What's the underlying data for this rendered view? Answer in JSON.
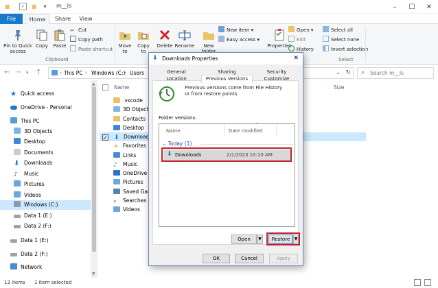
{
  "window": {
    "title": "m__ls"
  },
  "tabs": {
    "file": "File",
    "home": "Home",
    "share": "Share",
    "view": "View"
  },
  "ribbon": {
    "pin": "Pin to Quick access",
    "copy": "Copy",
    "paste": "Paste",
    "cut": "Cut",
    "copy_path": "Copy path",
    "paste_shortcut": "Paste shortcut",
    "move_to": "Move to",
    "copy_to": "Copy to",
    "delete": "Delete",
    "rename": "Rename",
    "new_folder": "New folder",
    "new_item": "New item",
    "easy_access": "Easy access",
    "properties": "Properties",
    "open": "Open",
    "edit": "Edit",
    "history": "History",
    "select_all": "Select all",
    "select_none": "Select none",
    "invert_selection": "Invert selection",
    "group_clipboard": "Clipboard",
    "group_select": "Select"
  },
  "address": {
    "path": [
      "This PC",
      "Windows (C:)",
      "Users"
    ],
    "search_placeholder": "Search m__ls"
  },
  "columns": {
    "name": "Name",
    "size": "Size"
  },
  "nav": [
    {
      "label": "Quick access",
      "icon": "star-icon"
    },
    {
      "label": "OneDrive - Personal",
      "icon": "cloud-icon"
    },
    {
      "label": "This PC",
      "icon": "pc-icon"
    },
    {
      "label": "3D Objects",
      "icon": "folder-icon"
    },
    {
      "label": "Desktop",
      "icon": "folder-icon"
    },
    {
      "label": "Documents",
      "icon": "folder-icon"
    },
    {
      "label": "Downloads",
      "icon": "download-icon"
    },
    {
      "label": "Music",
      "icon": "music-icon"
    },
    {
      "label": "Pictures",
      "icon": "folder-icon"
    },
    {
      "label": "Videos",
      "icon": "folder-icon"
    },
    {
      "label": "Windows (C:)",
      "icon": "drive-icon"
    },
    {
      "label": "Data 1 (E:)",
      "icon": "drive-icon"
    },
    {
      "label": "Data 2 (F:)",
      "icon": "drive-icon"
    },
    {
      "label": "Data 1 (E:)",
      "icon": "drive-icon"
    },
    {
      "label": "Data 2 (F:)",
      "icon": "drive-icon"
    },
    {
      "label": "Network",
      "icon": "network-icon"
    }
  ],
  "files": [
    ".vscode",
    "3D Objects",
    "Contacts",
    "Desktop",
    "Downloads",
    "Favorites",
    "Links",
    "Music",
    "OneDrive",
    "Pictures",
    "Saved Gam",
    "Searches",
    "Videos"
  ],
  "status": {
    "items": "13 items",
    "selected": "1 item selected"
  },
  "dialog": {
    "title": "Downloads Properties",
    "tabs_row1": [
      "General",
      "Sharing",
      "Security"
    ],
    "tabs_row2": [
      "Location",
      "Previous Versions",
      "Customize"
    ],
    "intro": "Previous versions come from File History or from restore points.",
    "folder_versions_label": "Folder versions:",
    "col_name": "Name",
    "col_date": "Date modified",
    "group": "Today (1)",
    "version_name": "Downloads",
    "version_date": "2/1/2023 10:10 AM",
    "open_btn": "Open",
    "restore_btn": "Restore",
    "ok": "OK",
    "cancel": "Cancel",
    "apply": "Apply"
  },
  "colors": {
    "accent": "#1979ca",
    "highlight": "#c4242e",
    "selection": "#cce8ff"
  }
}
